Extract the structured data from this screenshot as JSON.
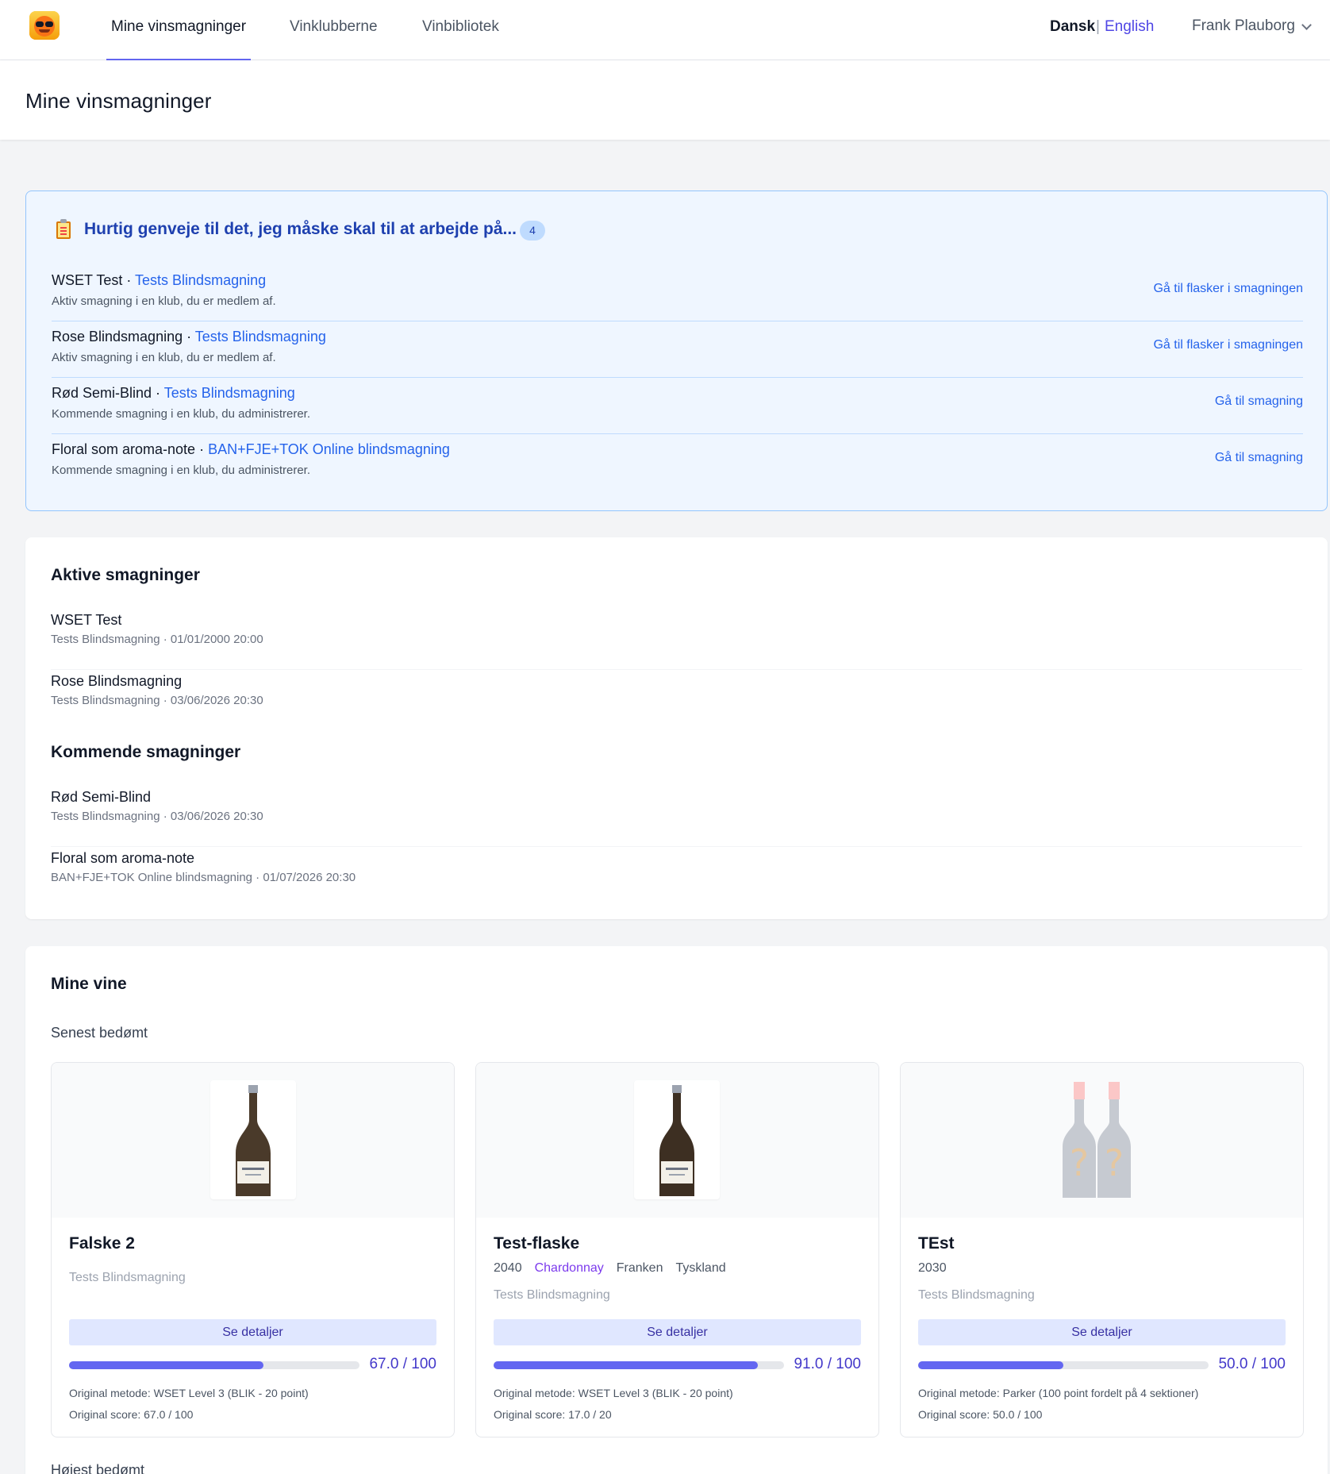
{
  "nav": {
    "tabs": [
      {
        "label": "Mine vinsmagninger",
        "active": true
      },
      {
        "label": "Vinklubberne",
        "active": false
      },
      {
        "label": "Vinbibliotek",
        "active": false
      }
    ],
    "lang_active": "Dansk",
    "lang_separator": "|",
    "lang_other": "English",
    "user": "Frank Plauborg"
  },
  "page_title": "Mine vinsmagninger",
  "shortcuts": {
    "title": "Hurtig genveje til det, jeg måske skal til at arbejde på...",
    "count": "4",
    "items": [
      {
        "tasting": "WSET Test",
        "separator": " · ",
        "club": "Tests Blindsmagning",
        "subtitle": "Aktiv smagning i en klub, du er medlem af.",
        "action": "Gå til flasker i smagningen"
      },
      {
        "tasting": "Rose Blindsmagning",
        "separator": " · ",
        "club": "Tests Blindsmagning",
        "subtitle": "Aktiv smagning i en klub, du er medlem af.",
        "action": "Gå til flasker i smagningen"
      },
      {
        "tasting": "Rød Semi-Blind",
        "separator": " · ",
        "club": "Tests Blindsmagning",
        "subtitle": "Kommende smagning i en klub, du administrerer.",
        "action": "Gå til smagning"
      },
      {
        "tasting": "Floral som aroma-note",
        "separator": " · ",
        "club": "BAN+FJE+TOK Online blindsmagning",
        "subtitle": "Kommende smagning i en klub, du administrerer.",
        "action": "Gå til smagning"
      }
    ]
  },
  "tastings": {
    "active_title": "Aktive smagninger",
    "active": [
      {
        "name": "WSET Test",
        "meta": "Tests Blindsmagning · 01/01/2000 20:00"
      },
      {
        "name": "Rose Blindsmagning",
        "meta": "Tests Blindsmagning · 03/06/2026 20:30"
      }
    ],
    "upcoming_title": "Kommende smagninger",
    "upcoming": [
      {
        "name": "Rød Semi-Blind",
        "meta": "Tests Blindsmagning · 03/06/2026 20:30"
      },
      {
        "name": "Floral som aroma-note",
        "meta": "BAN+FJE+TOK Online blindsmagning · 01/07/2026 20:30"
      }
    ]
  },
  "wines": {
    "title": "Mine vine",
    "recent_title": "Senest bedømt",
    "next_section_title": "Højest bedømt",
    "details_label": "Se detaljer",
    "items": [
      {
        "name": "Falske 2",
        "tags": [],
        "club": "Tests Blindsmagning",
        "score_label": "67.0 / 100",
        "score_fraction": 0.67,
        "original_method": "Original metode: WSET Level 3 (BLIK - 20 point)",
        "original_score": "Original score: 67.0 / 100",
        "image": "white-wine-bottle"
      },
      {
        "name": "Test-flaske",
        "tags": [
          {
            "text": "2040",
            "kind": "vintage"
          },
          {
            "text": "Chardonnay",
            "kind": "grape"
          },
          {
            "text": "Franken",
            "kind": "region"
          },
          {
            "text": "Tyskland",
            "kind": "country"
          }
        ],
        "club": "Tests Blindsmagning",
        "score_label": "91.0 / 100",
        "score_fraction": 0.91,
        "original_method": "Original metode: WSET Level 3 (BLIK - 20 point)",
        "original_score": "Original score: 17.0 / 20",
        "image": "white-wine-bottle"
      },
      {
        "name": "TEst",
        "tags": [
          {
            "text": "2030",
            "kind": "vintage"
          }
        ],
        "club": "Tests Blindsmagning",
        "score_label": "50.0 / 100",
        "score_fraction": 0.5,
        "original_method": "Original metode: Parker (100 point fordelt på 4 sektioner)",
        "original_score": "Original score: 50.0 / 100",
        "image": "unknown-bottles-placeholder"
      }
    ]
  },
  "colors": {
    "accent": "#6366f1",
    "link": "#2563eb",
    "grape": "#7c3aed",
    "shortcut_bg": "#eff6ff"
  }
}
